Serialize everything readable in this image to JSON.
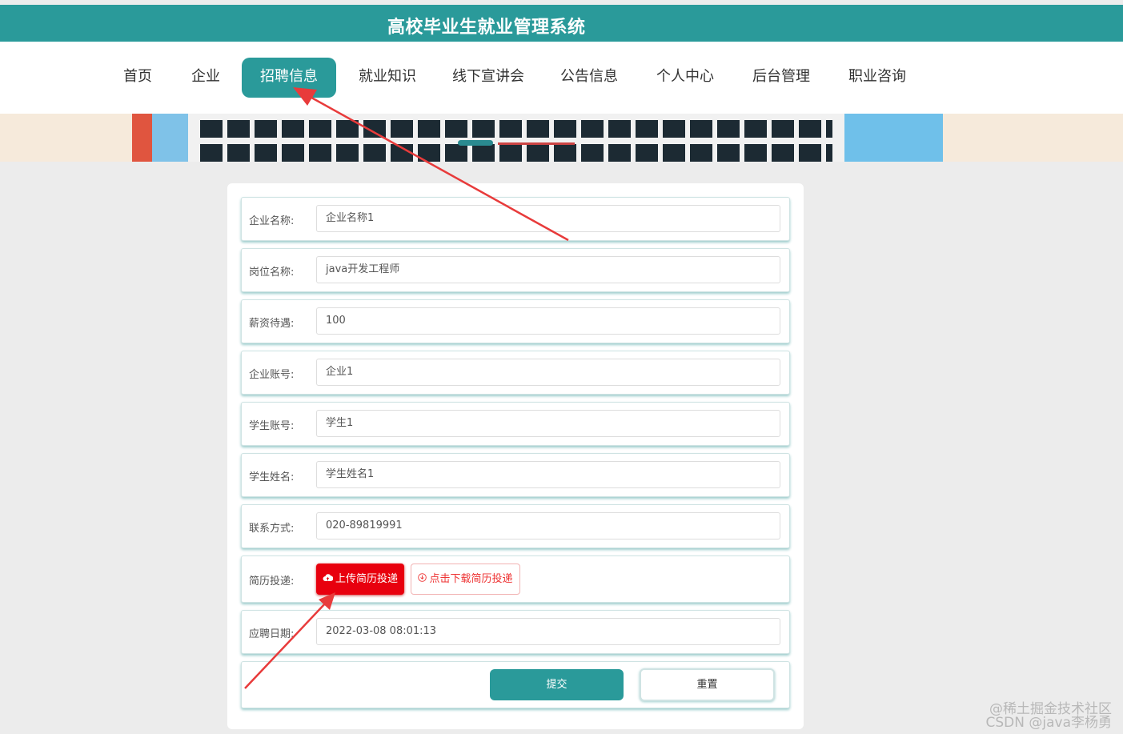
{
  "app": {
    "title": "高校毕业生就业管理系统"
  },
  "nav": {
    "items": [
      {
        "label": "首页"
      },
      {
        "label": "企业"
      },
      {
        "label": "招聘信息"
      },
      {
        "label": "就业知识"
      },
      {
        "label": "线下宣讲会"
      },
      {
        "label": "公告信息"
      },
      {
        "label": "个人中心"
      },
      {
        "label": "后台管理"
      },
      {
        "label": "职业咨询"
      }
    ],
    "active_index": 2
  },
  "form": {
    "fields": [
      {
        "label": "企业名称:",
        "value": "企业名称1"
      },
      {
        "label": "岗位名称:",
        "value": "java开发工程师"
      },
      {
        "label": "薪资待遇:",
        "value": "100"
      },
      {
        "label": "企业账号:",
        "value": "企业1"
      },
      {
        "label": "学生账号:",
        "value": "学生1"
      },
      {
        "label": "学生姓名:",
        "value": "学生姓名1"
      },
      {
        "label": "联系方式:",
        "value": "020-89819991"
      }
    ],
    "resume": {
      "label": "简历投递:",
      "upload_label": "上传简历投递",
      "download_label": "点击下载简历投递"
    },
    "date": {
      "label": "应聘日期:",
      "value": "2022-03-08 08:01:13"
    },
    "submit_label": "提交",
    "reset_label": "重置"
  },
  "watermark": {
    "line1": "@稀土掘金技术社区",
    "line2": "CSDN @java李杨勇"
  },
  "colors": {
    "primary": "#2a9a9a",
    "danger": "#e8000e",
    "annotation": "#e83b3b"
  }
}
